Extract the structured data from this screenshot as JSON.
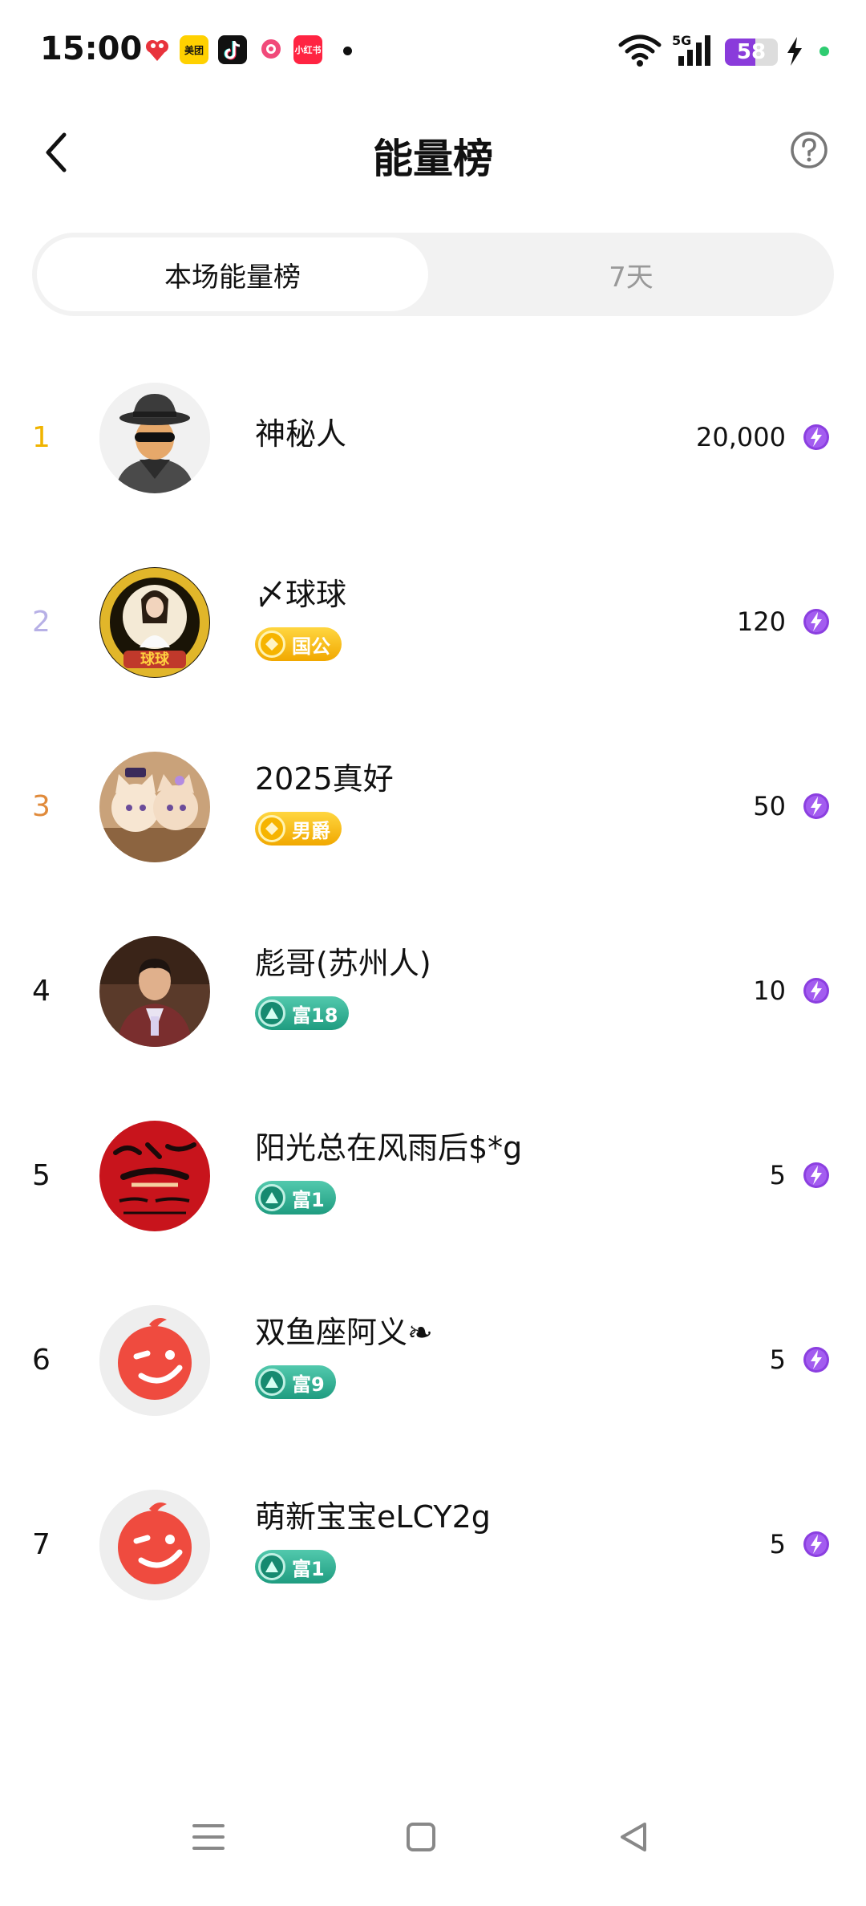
{
  "status_bar": {
    "time": "15:00",
    "apps": [
      {
        "name": "game-app-icon",
        "label": "",
        "color": "#e8333c"
      },
      {
        "name": "meituan-app-icon",
        "label": "美团",
        "color": "#ffd100"
      },
      {
        "name": "douyin-app-icon",
        "label": "",
        "color": "#111111"
      },
      {
        "name": "chat-app-icon",
        "label": "",
        "color": "#ffffff"
      },
      {
        "name": "xiaohongshu-app-icon",
        "label": "小红书",
        "color": "#ff2442"
      }
    ],
    "network": "5G",
    "battery_level": 58,
    "battery_text": "58",
    "battery_color": "#8a3bdb"
  },
  "header": {
    "title": "能量榜",
    "back_icon": "chevron-left-icon",
    "help_icon": "question-circle-icon"
  },
  "tabs": [
    {
      "label": "本场能量榜",
      "active": true
    },
    {
      "label": "7天",
      "active": false
    }
  ],
  "ranking": [
    {
      "rank": "1",
      "rank_color": "#f0b400",
      "name": "神秘人",
      "badge": null,
      "badge_type": null,
      "score": "20,000",
      "avatar": "mystery-person"
    },
    {
      "rank": "2",
      "rank_color": "#b7b0e6",
      "name": "〆球球",
      "badge": "国公",
      "badge_type": "gold",
      "score": "120",
      "avatar": "photo-gold-frame"
    },
    {
      "rank": "3",
      "rank_color": "#e08a3a",
      "name": "2025真好",
      "badge": "男爵",
      "badge_type": "gold",
      "score": "50",
      "avatar": "photo-cats"
    },
    {
      "rank": "4",
      "rank_color": "#111111",
      "name": "彪哥(苏州人)",
      "badge": "富18",
      "badge_type": "teal",
      "score": "10",
      "avatar": "photo-man"
    },
    {
      "rank": "5",
      "rank_color": "#111111",
      "name": "阳光总在风雨后$*g",
      "badge": "富1",
      "badge_type": "teal",
      "score": "5",
      "avatar": "photo-red-calligraphy"
    },
    {
      "rank": "6",
      "rank_color": "#111111",
      "name": "双鱼座阿义❧",
      "badge": "富9",
      "badge_type": "teal",
      "score": "5",
      "avatar": "default-wink"
    },
    {
      "rank": "7",
      "rank_color": "#111111",
      "name": "萌新宝宝eLCY2g",
      "badge": "富1",
      "badge_type": "teal",
      "score": "5",
      "avatar": "default-wink"
    }
  ],
  "energy_icon": "lightning-energy-icon",
  "energy_color": "#8b3fe0",
  "nav": [
    {
      "name": "menu-icon"
    },
    {
      "name": "home-icon"
    },
    {
      "name": "back-triangle-icon"
    }
  ]
}
